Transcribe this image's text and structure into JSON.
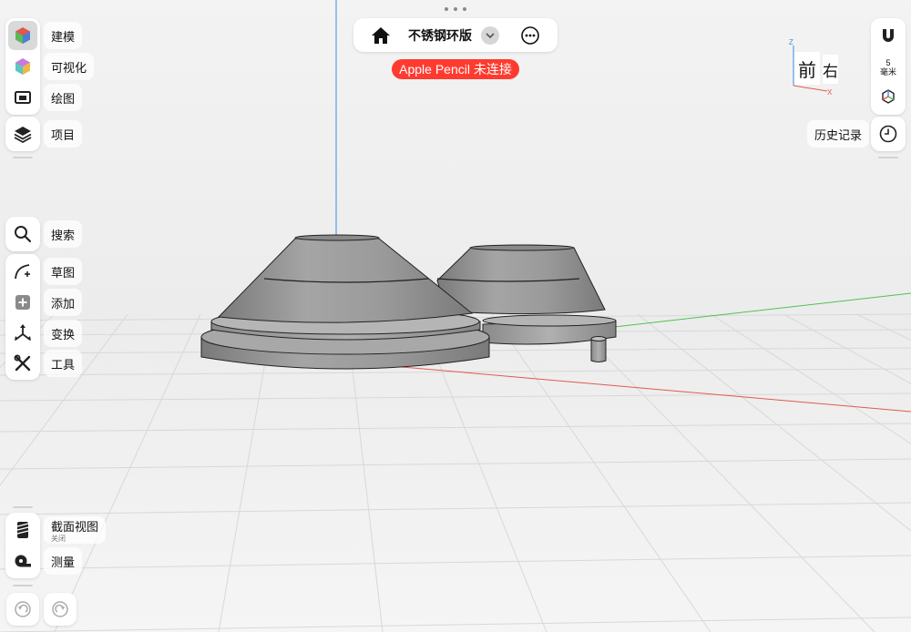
{
  "left_toolbar": {
    "modeling": "建模",
    "visualize": "可视化",
    "drawing": "绘图",
    "project": "项目",
    "search": "搜索",
    "sketch": "草图",
    "add": "添加",
    "transform": "变换",
    "tools": "工具",
    "section_view": "截面视图",
    "section_view_state": "关闭",
    "measure": "测量"
  },
  "top_bar": {
    "document_title": "不锈钢环版",
    "pencil_status": "Apple Pencil 未连接"
  },
  "right_toolbar": {
    "grid_value": "5",
    "grid_unit": "毫米",
    "history": "历史记录"
  },
  "view_cube": {
    "front": "前",
    "right": "右",
    "axis_z": "Z",
    "axis_x": "X"
  },
  "colors": {
    "pencil_badge": "#ff3b30",
    "axis_x": "#e05a4f",
    "axis_y": "#4fc24f",
    "axis_z": "#3a8ee6",
    "model_surface": "#8e8e8e"
  }
}
